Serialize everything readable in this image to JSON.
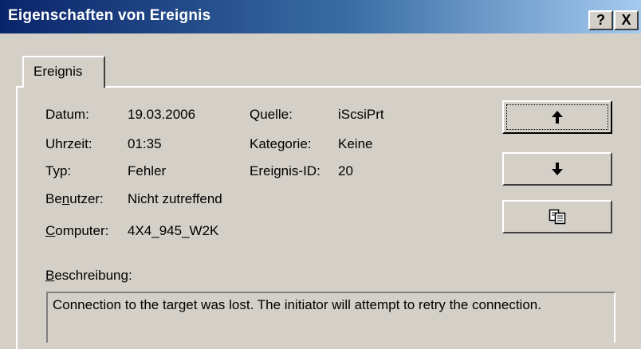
{
  "window": {
    "title": "Eigenschaften von Ereignis",
    "help_label": "?",
    "close_label": "X"
  },
  "tabs": [
    {
      "label": "Ereignis",
      "selected": true
    }
  ],
  "fields": {
    "datum_label": "Datum:",
    "datum_value": "19.03.2006",
    "uhrzeit_label": "Uhrzeit:",
    "uhrzeit_value": "01:35",
    "typ_label": "Typ:",
    "typ_value": "Fehler",
    "benutzer_label_pre": "Be",
    "benutzer_label_ul": "n",
    "benutzer_label_post": "utzer:",
    "benutzer_value": "Nicht zutreffend",
    "computer_label_ul": "C",
    "computer_label_post": "omputer:",
    "computer_value": "4X4_945_W2K",
    "quelle_label": "Quelle:",
    "quelle_value": "iScsiPrt",
    "kategorie_label": "Kategorie:",
    "kategorie_value": "Keine",
    "ereignis_id_label": "Ereignis-ID:",
    "ereignis_id_value": "20"
  },
  "buttons": {
    "up_icon": "arrow-up-icon",
    "down_icon": "arrow-down-icon",
    "copy_icon": "copy-icon"
  },
  "description": {
    "label_ul": "B",
    "label_post": "eschreibung:",
    "text": "Connection to the target was lost. The initiator will attempt to retry the connection."
  },
  "colors": {
    "titlebar_start": "#0a246a",
    "titlebar_end": "#a6caf0",
    "face": "#d4d0c8"
  }
}
